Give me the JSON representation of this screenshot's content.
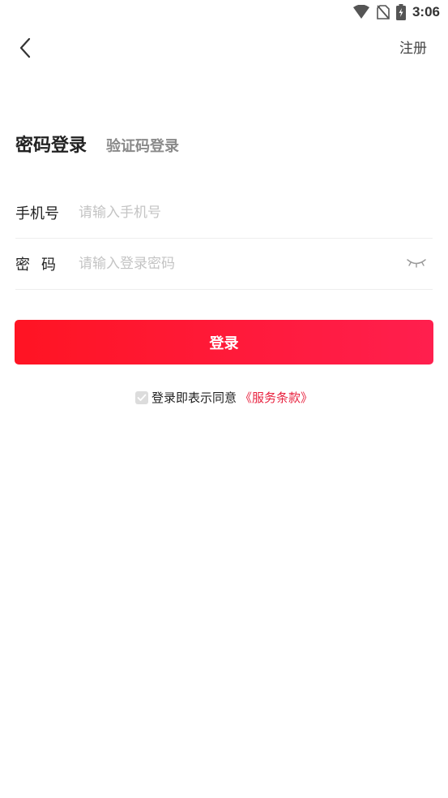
{
  "status_bar": {
    "time": "3:06",
    "icons": [
      "wifi-icon",
      "no-sim-icon",
      "battery-charging-icon"
    ]
  },
  "header": {
    "back_icon": "chevron-left-icon",
    "register_label": "注册"
  },
  "tabs": {
    "password_login": "密码登录",
    "code_login": "验证码登录"
  },
  "form": {
    "phone": {
      "label": "手机号",
      "placeholder": "请输入手机号",
      "value": ""
    },
    "password": {
      "label": "密码",
      "placeholder": "请输入登录密码",
      "value": "",
      "toggle_icon": "eye-closed-icon"
    }
  },
  "login_button_label": "登录",
  "agreement": {
    "checked": true,
    "text": "登录即表示同意",
    "terms_link": "《服务条款》"
  },
  "colors": {
    "accent": "#ff1f3e",
    "link": "#e8213e",
    "placeholder": "#c4c4c4",
    "divider": "#eeeeee"
  }
}
